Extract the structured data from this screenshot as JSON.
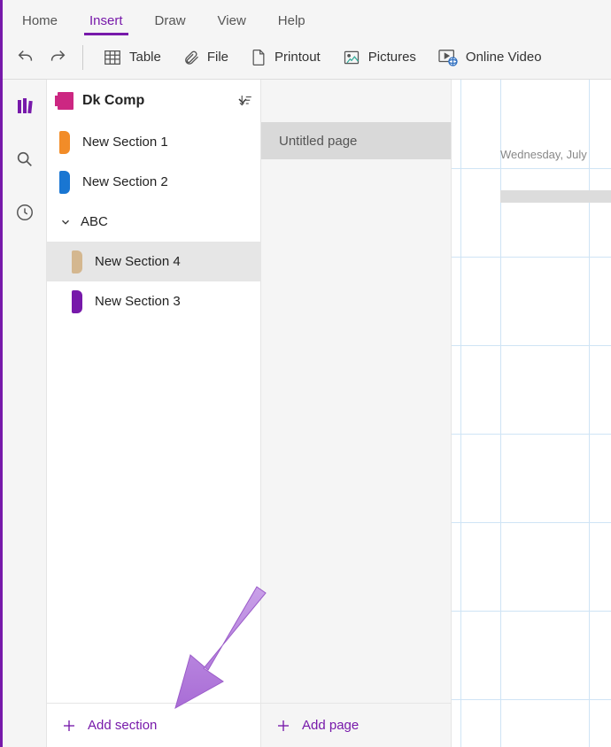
{
  "tabs": [
    {
      "label": "Home",
      "active": false
    },
    {
      "label": "Insert",
      "active": true
    },
    {
      "label": "Draw",
      "active": false
    },
    {
      "label": "View",
      "active": false
    },
    {
      "label": "Help",
      "active": false
    }
  ],
  "ribbon": {
    "table": "Table",
    "file": "File",
    "printout": "Printout",
    "pictures": "Pictures",
    "online_video": "Online Video"
  },
  "notebook": {
    "title": "Dk Comp"
  },
  "sections": [
    {
      "label": "New Section 1",
      "color": "#f28c28",
      "indent": false,
      "selected": false,
      "type": "section"
    },
    {
      "label": "New Section 2",
      "color": "#1976d2",
      "indent": false,
      "selected": false,
      "type": "section"
    },
    {
      "label": "ABC",
      "type": "group"
    },
    {
      "label": "New Section 4",
      "color": "#d4b78f",
      "indent": true,
      "selected": true,
      "type": "section"
    },
    {
      "label": "New Section 3",
      "color": "#7719aa",
      "indent": true,
      "selected": false,
      "type": "section"
    }
  ],
  "add_section": "Add section",
  "pages": [
    {
      "label": "Untitled page",
      "selected": true
    }
  ],
  "add_page": "Add page",
  "canvas": {
    "date": "Wednesday, July"
  },
  "accent": "#7719aa"
}
